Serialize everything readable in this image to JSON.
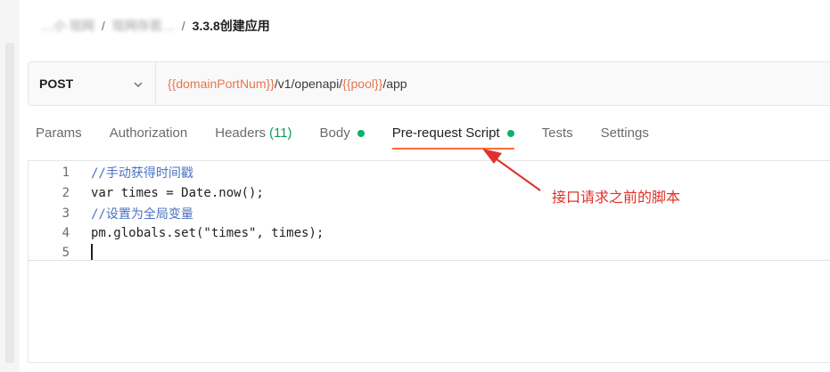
{
  "breadcrumb": {
    "items": [
      "…小 现网",
      "现网存若…"
    ],
    "current": "3.3.8创建应用"
  },
  "request": {
    "method": "POST",
    "url_parts": {
      "var1": "{{domainPortNum}}",
      "path1": "/v1/openapi/",
      "var2": "{{pool}}",
      "path2": "/app"
    }
  },
  "tabs": [
    {
      "label": "Params"
    },
    {
      "label": "Authorization"
    },
    {
      "label": "Headers",
      "count": "(11)"
    },
    {
      "label": "Body"
    },
    {
      "label": "Pre-request Script",
      "active": true
    },
    {
      "label": "Tests"
    },
    {
      "label": "Settings"
    }
  ],
  "editor": {
    "lines": [
      {
        "num": "1",
        "text": "//手动获得时间戳"
      },
      {
        "num": "2",
        "text": "var times = Date.now();"
      },
      {
        "num": "3",
        "text": "//设置为全局变量"
      },
      {
        "num": "4",
        "text": "pm.globals.set(\"times\", times);"
      },
      {
        "num": "5",
        "text": ""
      }
    ]
  },
  "annotation": "接口请求之前的脚本",
  "colors": {
    "accent": "#ff6c37",
    "variable": "#e8744e",
    "status_dot": "#0bb066",
    "annotation": "#e0312a"
  }
}
